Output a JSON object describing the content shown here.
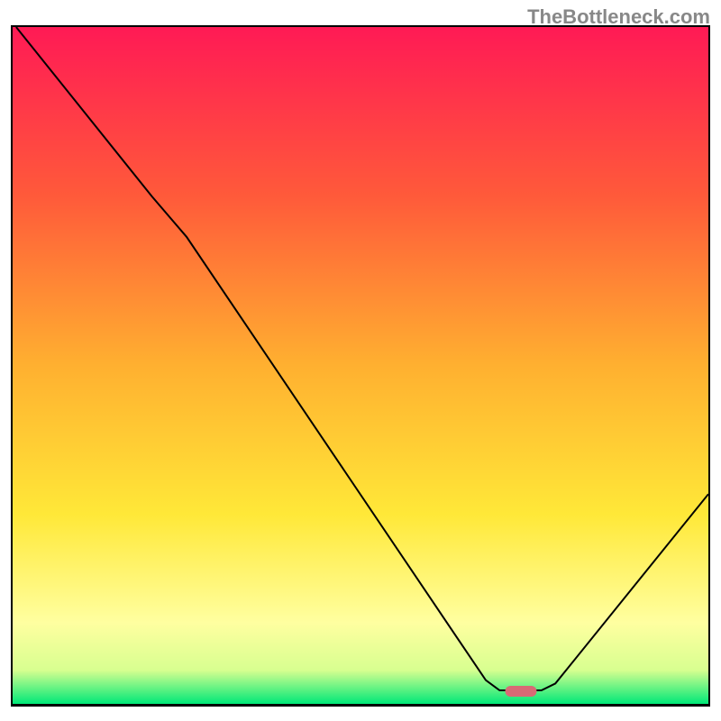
{
  "watermark": "TheBottleneck.com",
  "chart_data": {
    "type": "line",
    "title": "",
    "xlabel": "",
    "ylabel": "",
    "xlim": [
      0,
      100
    ],
    "ylim": [
      0,
      100
    ],
    "gradient_stops": [
      {
        "offset": 0.0,
        "color": "#ff1a55"
      },
      {
        "offset": 0.25,
        "color": "#ff5a3a"
      },
      {
        "offset": 0.5,
        "color": "#ffb030"
      },
      {
        "offset": 0.72,
        "color": "#ffe838"
      },
      {
        "offset": 0.88,
        "color": "#ffffa0"
      },
      {
        "offset": 0.95,
        "color": "#d8ff90"
      },
      {
        "offset": 1.0,
        "color": "#00e878"
      }
    ],
    "curve_points": [
      {
        "x": 0.5,
        "y": 100
      },
      {
        "x": 20,
        "y": 75
      },
      {
        "x": 25,
        "y": 69
      },
      {
        "x": 68,
        "y": 3.5
      },
      {
        "x": 70,
        "y": 2
      },
      {
        "x": 76,
        "y": 2
      },
      {
        "x": 78,
        "y": 3
      },
      {
        "x": 100,
        "y": 31
      }
    ],
    "marker": {
      "x": 73,
      "y": 2,
      "color": "#d86a75"
    }
  }
}
